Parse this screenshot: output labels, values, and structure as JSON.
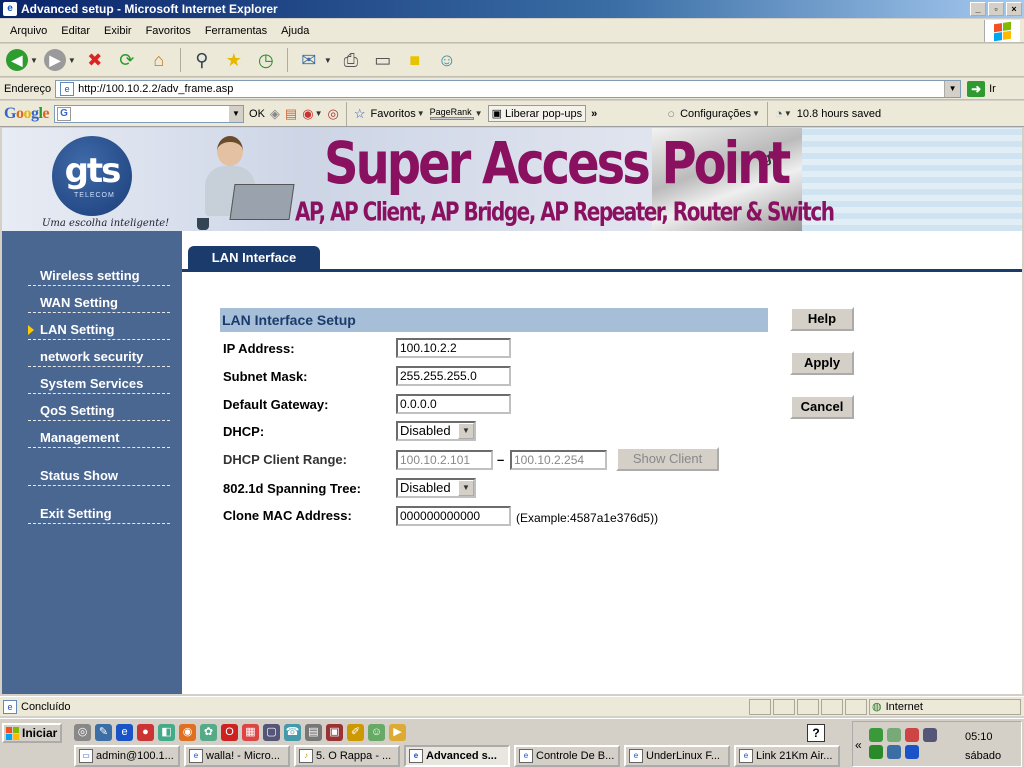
{
  "window": {
    "title": "Advanced setup - Microsoft Internet Explorer",
    "controls": [
      "_",
      "▫",
      "×"
    ]
  },
  "menu": {
    "items": [
      "Arquivo",
      "Editar",
      "Exibir",
      "Favoritos",
      "Ferramentas",
      "Ajuda"
    ]
  },
  "address": {
    "label": "Endereço",
    "url": "http://100.10.2.2/adv_frame.asp",
    "go_label": "Ir"
  },
  "google_bar": {
    "logo": "Google",
    "ok_label": "OK",
    "favorites_label": "Favoritos",
    "pagerank_label": "PageRank",
    "popups_label": "Liberar pop-ups",
    "settings_label": "Configurações",
    "saved_label": "10.8 hours saved"
  },
  "banner": {
    "logo_text": "gts",
    "logo_sub": "TELECOM",
    "tagline": "Uma escolha inteligente!",
    "title": "Super Access Point",
    "subtitle": "AP, AP Client, AP Bridge, AP Repeater, Router & Switch"
  },
  "sidebar": {
    "items": [
      {
        "label": "Wireless setting"
      },
      {
        "label": "WAN Setting"
      },
      {
        "label": "LAN Setting",
        "active": true
      },
      {
        "label": "network security"
      },
      {
        "label": "System Services"
      },
      {
        "label": "QoS Setting"
      },
      {
        "label": "Management"
      },
      {
        "label": "Status Show"
      },
      {
        "label": "Exit Setting"
      }
    ]
  },
  "tab": {
    "label": "LAN Interface"
  },
  "form": {
    "section_title": "LAN Interface Setup",
    "ip_label": "IP Address:",
    "ip_value": "100.10.2.2",
    "subnet_label": "Subnet Mask:",
    "subnet_value": "255.255.255.0",
    "gateway_label": "Default Gateway:",
    "gateway_value": "0.0.0.0",
    "dhcp_label": "DHCP:",
    "dhcp_value": "Disabled",
    "range_label": "DHCP Client Range:",
    "range_start": "100.10.2.101",
    "range_sep": "–",
    "range_end": "100.10.2.254",
    "show_client_label": "Show Client",
    "stp_label": "802.1d Spanning Tree:",
    "stp_value": "Disabled",
    "mac_label": "Clone MAC Address:",
    "mac_value": "000000000000",
    "mac_example": "(Example:4587a1e376d5))"
  },
  "buttons": {
    "help": "Help",
    "apply": "Apply",
    "cancel": "Cancel"
  },
  "status": {
    "text": "Concluído",
    "zone": "Internet"
  },
  "taskbar": {
    "start_label": "Iniciar",
    "tasks": [
      {
        "label": "admin@100.1..."
      },
      {
        "label": "walla! - Micro..."
      },
      {
        "label": "5. O Rappa - ..."
      },
      {
        "label": "Advanced s...",
        "active": true
      },
      {
        "label": "Controle De B..."
      },
      {
        "label": "UnderLinux F..."
      },
      {
        "label": "Link 21Km Air..."
      }
    ],
    "clock": "05:10",
    "day": "sábado"
  },
  "colors": {
    "sidebar_bg": "#4a6792",
    "tab_bg": "#1a3b6b",
    "section_header_bg": "#a6bed8",
    "banner_title": "#8a1060"
  }
}
